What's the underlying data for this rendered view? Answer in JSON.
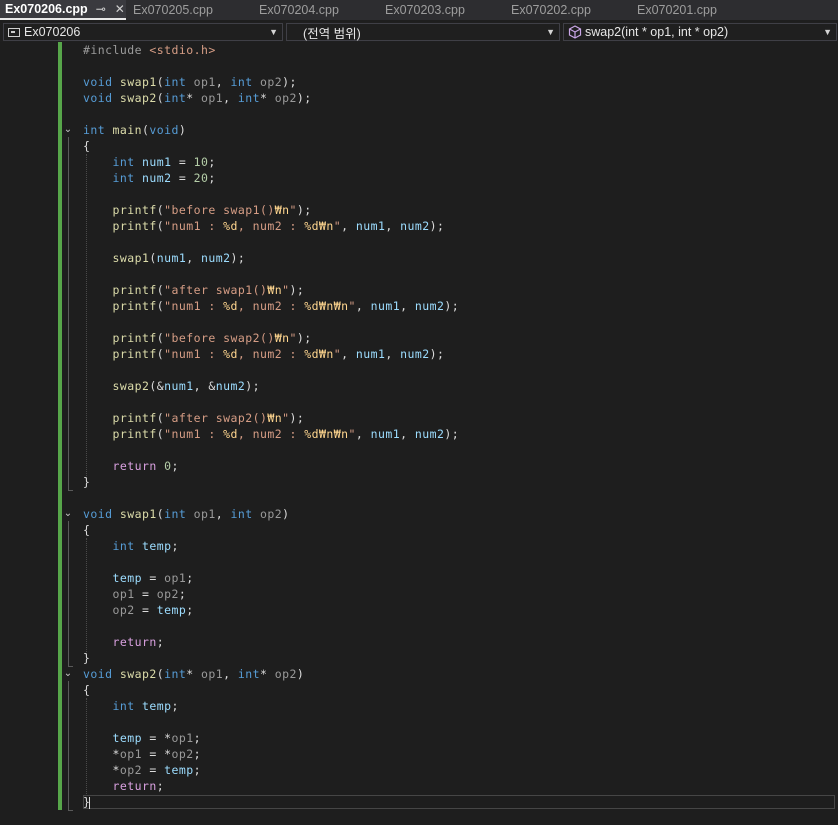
{
  "tabs": [
    {
      "label": "Ex070206.cpp",
      "active": true
    },
    {
      "label": "Ex070205.cpp",
      "active": false
    },
    {
      "label": "Ex070204.cpp",
      "active": false
    },
    {
      "label": "Ex070203.cpp",
      "active": false
    },
    {
      "label": "Ex070202.cpp",
      "active": false
    },
    {
      "label": "Ex070201.cpp",
      "active": false
    }
  ],
  "tab_icons": {
    "pin": "pin-icon",
    "close": "close-icon"
  },
  "navbar": {
    "project": "Ex070206",
    "scope": "(전역 범위)",
    "member": "swap2(int * op1, int * op2)"
  },
  "colors": {
    "background": "#1e1e1e",
    "keyword": "#569cd6",
    "control": "#d8a0df",
    "function": "#dcdcaa",
    "string": "#d69d85",
    "number": "#b5cea8",
    "change_bar": "#57a64a"
  },
  "code_lines": [
    [
      [
        "pp",
        "#include "
      ],
      [
        "inc",
        "<stdio.h>"
      ]
    ],
    [],
    [
      [
        "kw",
        "void "
      ],
      [
        "fn",
        "swap1"
      ],
      [
        "pl",
        "("
      ],
      [
        "kw",
        "int "
      ],
      [
        "prm",
        "op1"
      ],
      [
        "pl",
        ", "
      ],
      [
        "kw",
        "int "
      ],
      [
        "prm",
        "op2"
      ],
      [
        "pl",
        ");"
      ]
    ],
    [
      [
        "kw",
        "void "
      ],
      [
        "fn",
        "swap2"
      ],
      [
        "pl",
        "("
      ],
      [
        "kw",
        "int"
      ],
      [
        "pl",
        "* "
      ],
      [
        "prm",
        "op1"
      ],
      [
        "pl",
        ", "
      ],
      [
        "kw",
        "int"
      ],
      [
        "pl",
        "* "
      ],
      [
        "prm",
        "op2"
      ],
      [
        "pl",
        ");"
      ]
    ],
    [],
    [
      [
        "kw",
        "int "
      ],
      [
        "fn",
        "main"
      ],
      [
        "pl",
        "("
      ],
      [
        "kw",
        "void"
      ],
      [
        "pl",
        ")"
      ]
    ],
    [
      [
        "pl",
        "{"
      ]
    ],
    [
      [
        "pl",
        "    "
      ],
      [
        "kw",
        "int "
      ],
      [
        "var",
        "num1"
      ],
      [
        "pl",
        " = "
      ],
      [
        "num",
        "10"
      ],
      [
        "pl",
        ";"
      ]
    ],
    [
      [
        "pl",
        "    "
      ],
      [
        "kw",
        "int "
      ],
      [
        "var",
        "num2"
      ],
      [
        "pl",
        " = "
      ],
      [
        "num",
        "20"
      ],
      [
        "pl",
        ";"
      ]
    ],
    [],
    [
      [
        "pl",
        "    "
      ],
      [
        "fn",
        "printf"
      ],
      [
        "pl",
        "("
      ],
      [
        "str",
        "\"before swap1()"
      ],
      [
        "esc",
        "₩n"
      ],
      [
        "str",
        "\""
      ],
      [
        "pl",
        ");"
      ]
    ],
    [
      [
        "pl",
        "    "
      ],
      [
        "fn",
        "printf"
      ],
      [
        "pl",
        "("
      ],
      [
        "str",
        "\"num1 : "
      ],
      [
        "esc",
        "%d"
      ],
      [
        "str",
        ", num2 : "
      ],
      [
        "esc",
        "%d₩n"
      ],
      [
        "str",
        "\""
      ],
      [
        "pl",
        ", "
      ],
      [
        "var",
        "num1"
      ],
      [
        "pl",
        ", "
      ],
      [
        "var",
        "num2"
      ],
      [
        "pl",
        ");"
      ]
    ],
    [],
    [
      [
        "pl",
        "    "
      ],
      [
        "fn",
        "swap1"
      ],
      [
        "pl",
        "("
      ],
      [
        "var",
        "num1"
      ],
      [
        "pl",
        ", "
      ],
      [
        "var",
        "num2"
      ],
      [
        "pl",
        ");"
      ]
    ],
    [],
    [
      [
        "pl",
        "    "
      ],
      [
        "fn",
        "printf"
      ],
      [
        "pl",
        "("
      ],
      [
        "str",
        "\"after swap1()"
      ],
      [
        "esc",
        "₩n"
      ],
      [
        "str",
        "\""
      ],
      [
        "pl",
        ");"
      ]
    ],
    [
      [
        "pl",
        "    "
      ],
      [
        "fn",
        "printf"
      ],
      [
        "pl",
        "("
      ],
      [
        "str",
        "\"num1 : "
      ],
      [
        "esc",
        "%d"
      ],
      [
        "str",
        ", num2 : "
      ],
      [
        "esc",
        "%d₩n₩n"
      ],
      [
        "str",
        "\""
      ],
      [
        "pl",
        ", "
      ],
      [
        "var",
        "num1"
      ],
      [
        "pl",
        ", "
      ],
      [
        "var",
        "num2"
      ],
      [
        "pl",
        ");"
      ]
    ],
    [],
    [
      [
        "pl",
        "    "
      ],
      [
        "fn",
        "printf"
      ],
      [
        "pl",
        "("
      ],
      [
        "str",
        "\"before swap2()"
      ],
      [
        "esc",
        "₩n"
      ],
      [
        "str",
        "\""
      ],
      [
        "pl",
        ");"
      ]
    ],
    [
      [
        "pl",
        "    "
      ],
      [
        "fn",
        "printf"
      ],
      [
        "pl",
        "("
      ],
      [
        "str",
        "\"num1 : "
      ],
      [
        "esc",
        "%d"
      ],
      [
        "str",
        ", num2 : "
      ],
      [
        "esc",
        "%d₩n"
      ],
      [
        "str",
        "\""
      ],
      [
        "pl",
        ", "
      ],
      [
        "var",
        "num1"
      ],
      [
        "pl",
        ", "
      ],
      [
        "var",
        "num2"
      ],
      [
        "pl",
        ");"
      ]
    ],
    [],
    [
      [
        "pl",
        "    "
      ],
      [
        "fn",
        "swap2"
      ],
      [
        "pl",
        "(&"
      ],
      [
        "var",
        "num1"
      ],
      [
        "pl",
        ", &"
      ],
      [
        "var",
        "num2"
      ],
      [
        "pl",
        ");"
      ]
    ],
    [],
    [
      [
        "pl",
        "    "
      ],
      [
        "fn",
        "printf"
      ],
      [
        "pl",
        "("
      ],
      [
        "str",
        "\"after swap2()"
      ],
      [
        "esc",
        "₩n"
      ],
      [
        "str",
        "\""
      ],
      [
        "pl",
        ");"
      ]
    ],
    [
      [
        "pl",
        "    "
      ],
      [
        "fn",
        "printf"
      ],
      [
        "pl",
        "("
      ],
      [
        "str",
        "\"num1 : "
      ],
      [
        "esc",
        "%d"
      ],
      [
        "str",
        ", num2 : "
      ],
      [
        "esc",
        "%d₩n₩n"
      ],
      [
        "str",
        "\""
      ],
      [
        "pl",
        ", "
      ],
      [
        "var",
        "num1"
      ],
      [
        "pl",
        ", "
      ],
      [
        "var",
        "num2"
      ],
      [
        "pl",
        ");"
      ]
    ],
    [],
    [
      [
        "pl",
        "    "
      ],
      [
        "ctl",
        "return "
      ],
      [
        "num",
        "0"
      ],
      [
        "pl",
        ";"
      ]
    ],
    [
      [
        "pl",
        "}"
      ]
    ],
    [],
    [
      [
        "kw",
        "void "
      ],
      [
        "fn",
        "swap1"
      ],
      [
        "pl",
        "("
      ],
      [
        "kw",
        "int "
      ],
      [
        "prm",
        "op1"
      ],
      [
        "pl",
        ", "
      ],
      [
        "kw",
        "int "
      ],
      [
        "prm",
        "op2"
      ],
      [
        "pl",
        ")"
      ]
    ],
    [
      [
        "pl",
        "{"
      ]
    ],
    [
      [
        "pl",
        "    "
      ],
      [
        "kw",
        "int "
      ],
      [
        "var",
        "temp"
      ],
      [
        "pl",
        ";"
      ]
    ],
    [],
    [
      [
        "pl",
        "    "
      ],
      [
        "var",
        "temp"
      ],
      [
        "pl",
        " = "
      ],
      [
        "prm",
        "op1"
      ],
      [
        "pl",
        ";"
      ]
    ],
    [
      [
        "pl",
        "    "
      ],
      [
        "prm",
        "op1"
      ],
      [
        "pl",
        " = "
      ],
      [
        "prm",
        "op2"
      ],
      [
        "pl",
        ";"
      ]
    ],
    [
      [
        "pl",
        "    "
      ],
      [
        "prm",
        "op2"
      ],
      [
        "pl",
        " = "
      ],
      [
        "var",
        "temp"
      ],
      [
        "pl",
        ";"
      ]
    ],
    [],
    [
      [
        "pl",
        "    "
      ],
      [
        "ctl",
        "return"
      ],
      [
        "pl",
        ";"
      ]
    ],
    [
      [
        "pl",
        "}"
      ]
    ],
    [
      [
        "kw",
        "void "
      ],
      [
        "fn",
        "swap2"
      ],
      [
        "pl",
        "("
      ],
      [
        "kw",
        "int"
      ],
      [
        "pl",
        "* "
      ],
      [
        "prm",
        "op1"
      ],
      [
        "pl",
        ", "
      ],
      [
        "kw",
        "int"
      ],
      [
        "pl",
        "* "
      ],
      [
        "prm",
        "op2"
      ],
      [
        "pl",
        ")"
      ]
    ],
    [
      [
        "pl",
        "{"
      ]
    ],
    [
      [
        "pl",
        "    "
      ],
      [
        "kw",
        "int "
      ],
      [
        "var",
        "temp"
      ],
      [
        "pl",
        ";"
      ]
    ],
    [],
    [
      [
        "pl",
        "    "
      ],
      [
        "var",
        "temp"
      ],
      [
        "pl",
        " = *"
      ],
      [
        "prm",
        "op1"
      ],
      [
        "pl",
        ";"
      ]
    ],
    [
      [
        "pl",
        "    *"
      ],
      [
        "prm",
        "op1"
      ],
      [
        "pl",
        " = *"
      ],
      [
        "prm",
        "op2"
      ],
      [
        "pl",
        ";"
      ]
    ],
    [
      [
        "pl",
        "    *"
      ],
      [
        "prm",
        "op2"
      ],
      [
        "pl",
        " = "
      ],
      [
        "var",
        "temp"
      ],
      [
        "pl",
        ";"
      ]
    ],
    [
      [
        "pl",
        "    "
      ],
      [
        "ctl",
        "return"
      ],
      [
        "pl",
        ";"
      ]
    ],
    [
      [
        "pl",
        "}"
      ]
    ]
  ]
}
